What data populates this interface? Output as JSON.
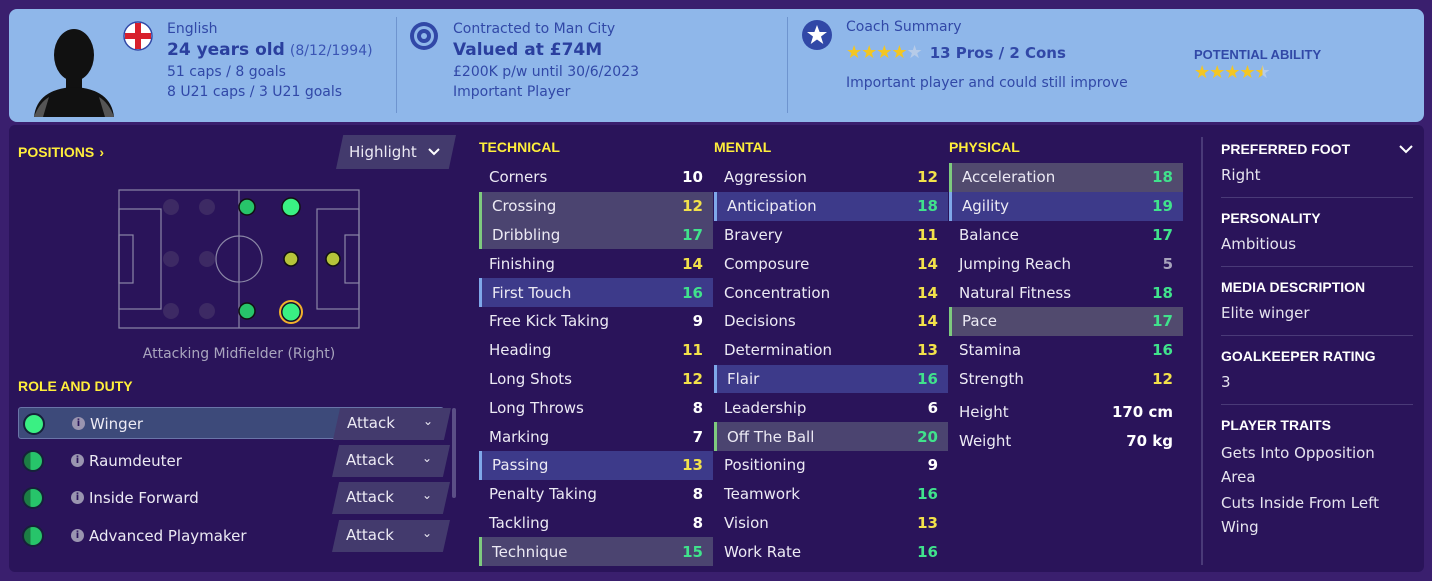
{
  "header": {
    "nationality": "English",
    "age": "24 years old",
    "dob": "(8/12/1994)",
    "caps": "51 caps / 8 goals",
    "u21": "8 U21 caps / 3 U21 goals",
    "contract_title": "Contracted to Man City",
    "value": "Valued at £74M",
    "wage": "£200K p/w until 30/6/2023",
    "status": "Important Player",
    "coach_title": "Coach Summary",
    "pros_cons": "13 Pros / 2 Cons",
    "coach_note": "Important player and could still improve",
    "potential_label": "POTENTIAL ABILITY",
    "current_stars": 4,
    "potential_stars": 4.5
  },
  "positions": {
    "label": "POSITIONS",
    "highlight": "Highlight",
    "caption": "Attacking Midfielder (Right)"
  },
  "roles": {
    "label": "ROLE AND DUTY",
    "items": [
      {
        "name": "Winger",
        "duty": "Attack"
      },
      {
        "name": "Raumdeuter",
        "duty": "Attack"
      },
      {
        "name": "Inside Forward",
        "duty": "Attack"
      },
      {
        "name": "Advanced Playmaker",
        "duty": "Attack"
      }
    ]
  },
  "technical": {
    "label": "TECHNICAL",
    "rows": [
      {
        "name": "Corners",
        "value": "10"
      },
      {
        "name": "Crossing",
        "value": "12"
      },
      {
        "name": "Dribbling",
        "value": "17"
      },
      {
        "name": "Finishing",
        "value": "14"
      },
      {
        "name": "First Touch",
        "value": "16"
      },
      {
        "name": "Free Kick Taking",
        "value": "9"
      },
      {
        "name": "Heading",
        "value": "11"
      },
      {
        "name": "Long Shots",
        "value": "12"
      },
      {
        "name": "Long Throws",
        "value": "8"
      },
      {
        "name": "Marking",
        "value": "7"
      },
      {
        "name": "Passing",
        "value": "13"
      },
      {
        "name": "Penalty Taking",
        "value": "8"
      },
      {
        "name": "Tackling",
        "value": "8"
      },
      {
        "name": "Technique",
        "value": "15"
      }
    ]
  },
  "mental": {
    "label": "MENTAL",
    "rows": [
      {
        "name": "Aggression",
        "value": "12"
      },
      {
        "name": "Anticipation",
        "value": "18"
      },
      {
        "name": "Bravery",
        "value": "11"
      },
      {
        "name": "Composure",
        "value": "14"
      },
      {
        "name": "Concentration",
        "value": "14"
      },
      {
        "name": "Decisions",
        "value": "14"
      },
      {
        "name": "Determination",
        "value": "13"
      },
      {
        "name": "Flair",
        "value": "16"
      },
      {
        "name": "Leadership",
        "value": "6"
      },
      {
        "name": "Off The Ball",
        "value": "20"
      },
      {
        "name": "Positioning",
        "value": "9"
      },
      {
        "name": "Teamwork",
        "value": "16"
      },
      {
        "name": "Vision",
        "value": "13"
      },
      {
        "name": "Work Rate",
        "value": "16"
      }
    ]
  },
  "physical": {
    "label": "PHYSICAL",
    "rows": [
      {
        "name": "Acceleration",
        "value": "18"
      },
      {
        "name": "Agility",
        "value": "19"
      },
      {
        "name": "Balance",
        "value": "17"
      },
      {
        "name": "Jumping Reach",
        "value": "5"
      },
      {
        "name": "Natural Fitness",
        "value": "18"
      },
      {
        "name": "Pace",
        "value": "17"
      },
      {
        "name": "Stamina",
        "value": "16"
      },
      {
        "name": "Strength",
        "value": "12"
      }
    ],
    "height_label": "Height",
    "height": "170 cm",
    "weight_label": "Weight",
    "weight": "70 kg"
  },
  "info": {
    "foot_label": "PREFERRED FOOT",
    "foot": "Right",
    "personality_label": "PERSONALITY",
    "personality": "Ambitious",
    "media_label": "MEDIA DESCRIPTION",
    "media": "Elite winger",
    "gk_label": "GOALKEEPER RATING",
    "gk": "3",
    "traits_label": "PLAYER TRAITS",
    "traits": [
      "Gets Into Opposition Area",
      "Cuts Inside From Left Wing"
    ]
  },
  "colors": {
    "accent_yellow": "#ffee3b",
    "value_green": "#40e28c",
    "value_yellow": "#f2e14a",
    "header_bg": "#8fb7ea",
    "panel_bg": "#2a145a"
  }
}
